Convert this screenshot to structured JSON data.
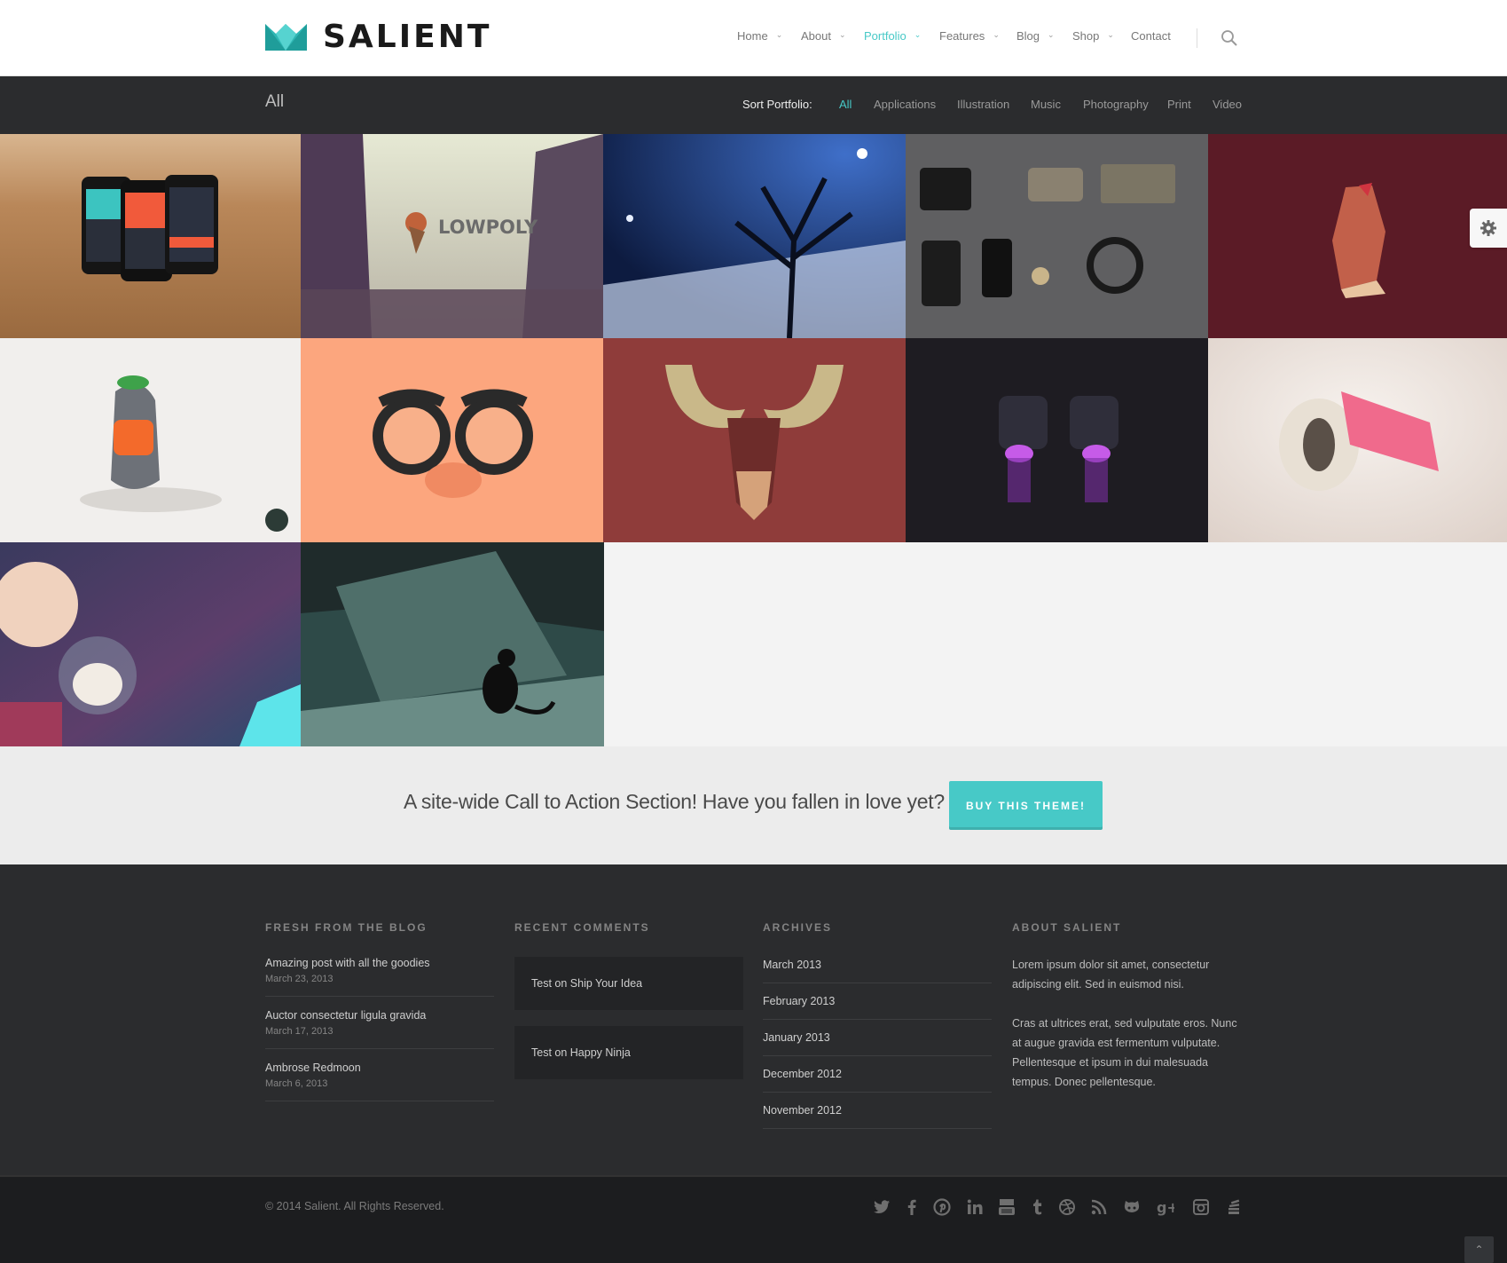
{
  "brand": {
    "name": "SALIENT",
    "accent": "#47c9c7"
  },
  "nav": {
    "items": [
      {
        "label": "Home",
        "dropdown": true,
        "active": false
      },
      {
        "label": "About",
        "dropdown": true,
        "active": false
      },
      {
        "label": "Portfolio",
        "dropdown": true,
        "active": true
      },
      {
        "label": "Features",
        "dropdown": true,
        "active": false
      },
      {
        "label": "Blog",
        "dropdown": true,
        "active": false
      },
      {
        "label": "Shop",
        "dropdown": true,
        "active": false
      },
      {
        "label": "Contact",
        "dropdown": false,
        "active": false
      }
    ],
    "search_icon": "search-icon"
  },
  "portfolio": {
    "title": "All",
    "sort_label": "Sort Portfolio:",
    "filters": [
      "All",
      "Applications",
      "Illustration",
      "Music",
      "Photography",
      "Print",
      "Video"
    ],
    "active_filter": "All",
    "items": [
      "weather app phones on beach",
      "lowpoly social app bird logo",
      "night tree and street lamps",
      "flat lay accessories",
      "illustrated man profile",
      "pigeon character illustration",
      "groucho glasses illustration",
      "moose head illustration",
      "purple binoculars",
      "3d toy render",
      "astronaut kid and dog",
      "black cat on stairs"
    ]
  },
  "cta": {
    "text": "A site-wide Call to Action Section! Have you fallen in love yet?",
    "button": "BUY THIS THEME!"
  },
  "footer": {
    "blog": {
      "title": "FRESH FROM THE BLOG",
      "posts": [
        {
          "title": "Amazing post with all the goodies",
          "date": "March 23, 2013"
        },
        {
          "title": "Auctor consectetur ligula gravida",
          "date": "March 17, 2013"
        },
        {
          "title": "Ambrose Redmoon",
          "date": "March 6, 2013"
        }
      ]
    },
    "comments": {
      "title": "RECENT COMMENTS",
      "items": [
        "Test on Ship Your Idea",
        "Test on Happy Ninja"
      ]
    },
    "archives": {
      "title": "ARCHIVES",
      "items": [
        "March 2013",
        "February 2013",
        "January 2013",
        "December 2012",
        "November 2012"
      ]
    },
    "about": {
      "title": "ABOUT SALIENT",
      "p1": "Lorem ipsum dolor sit amet, consectetur adipiscing elit. Sed in euismod nisi.",
      "p2": "Cras at ultrices erat, sed vulputate eros. Nunc at augue gravida est fermentum vulputate. Pellentesque et ipsum in dui malesuada tempus. Donec pellentesque."
    }
  },
  "bottom": {
    "copyright": "© 2014 Salient. All Rights Reserved.",
    "social_icons": [
      "twitter-icon",
      "facebook-icon",
      "pinterest-icon",
      "linkedin-icon",
      "youtube-icon",
      "tumblr-icon",
      "dribbble-icon",
      "rss-icon",
      "github-icon",
      "google-plus-icon",
      "instagram-icon",
      "stackexchange-icon"
    ]
  }
}
